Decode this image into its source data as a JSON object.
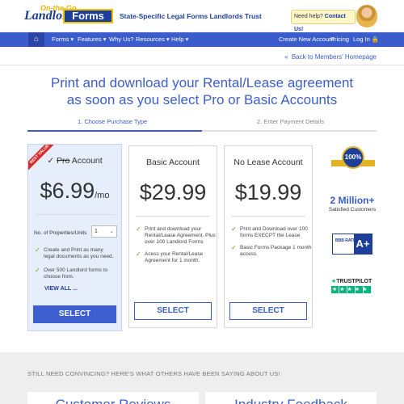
{
  "header": {
    "logo_script": "Landlord",
    "logo_small": "On-the-Go",
    "logo_box": "Forms",
    "tagline": "State-Specific Legal Forms Landlords Trust",
    "help_prefix": "Need help?",
    "help_link": "Contact Us!"
  },
  "nav": {
    "home_icon": "⌂",
    "items": [
      "Forms ▾",
      "Features ▾",
      "Why Us?",
      "Resources ▾",
      "Help ▾"
    ],
    "right_items": [
      "Create New Account",
      "Pricing",
      "Log In 🔒"
    ]
  },
  "back": {
    "arrow": "«",
    "prefix": "Back to",
    "link": "Members' Homepage"
  },
  "headline": {
    "line1": "Print and download your Rental/Lease agreement",
    "line2": "as soon as you select Pro or Basic Accounts"
  },
  "steps": {
    "step1": "1. Choose Purchase Type",
    "step2": "2. Enter Payment Details",
    "progress": 0.5
  },
  "plans": {
    "pro": {
      "ribbon": "BEST VALUE",
      "check": "✓",
      "title_strike": "Pro",
      "title_rest": "Account",
      "price": "$6.99",
      "per": "/mo",
      "units_label": "No. of Properties/Units",
      "units_value": "1",
      "features": [
        "Create and Print as many legal documents as you need.",
        "Over 500 Landlord forms to choose from."
      ],
      "view_all": "VIEW ALL ...",
      "button": "SELECT"
    },
    "basic": {
      "title": "Basic Account",
      "price": "$29.99",
      "features": [
        "Print and download your Rental/Lease Agreement. Plus over 100 Landlord Forms",
        "Acess your Rental/Lease Agreement for 1 month."
      ],
      "button": "SELECT"
    },
    "nolease": {
      "title": "No Lease Account",
      "price": "$19.99",
      "features": [
        "Print and Download over 100 forms EXECPT the Lease",
        "Basic Forms Package 1 month access"
      ],
      "button": "SELECT"
    }
  },
  "trust": {
    "guarantee": "100%",
    "customers_count": "2 Million+",
    "customers_label": "Satisfied Customers",
    "bbb_left": "BBB RATING",
    "bbb_grade": "A+",
    "trustpilot": "TRUSTPILOT",
    "trustpilot_star": "★",
    "trustpilot_stars": "★★★★★"
  },
  "testimonials": {
    "heading": "STILL NEED CONVINCING? HERE'S WHAT OTHERS HAVE BEEN SAYING ABOUT US!",
    "left_title": "Customer Reviews",
    "right_title": "Industry Feedback"
  },
  "colors": {
    "brand_blue": "#3b5ccd",
    "nav_blue": "#3b5ccd",
    "check_green": "#5aa51e",
    "ribbon_red": "#d92b2b",
    "gold": "#e4b324"
  }
}
